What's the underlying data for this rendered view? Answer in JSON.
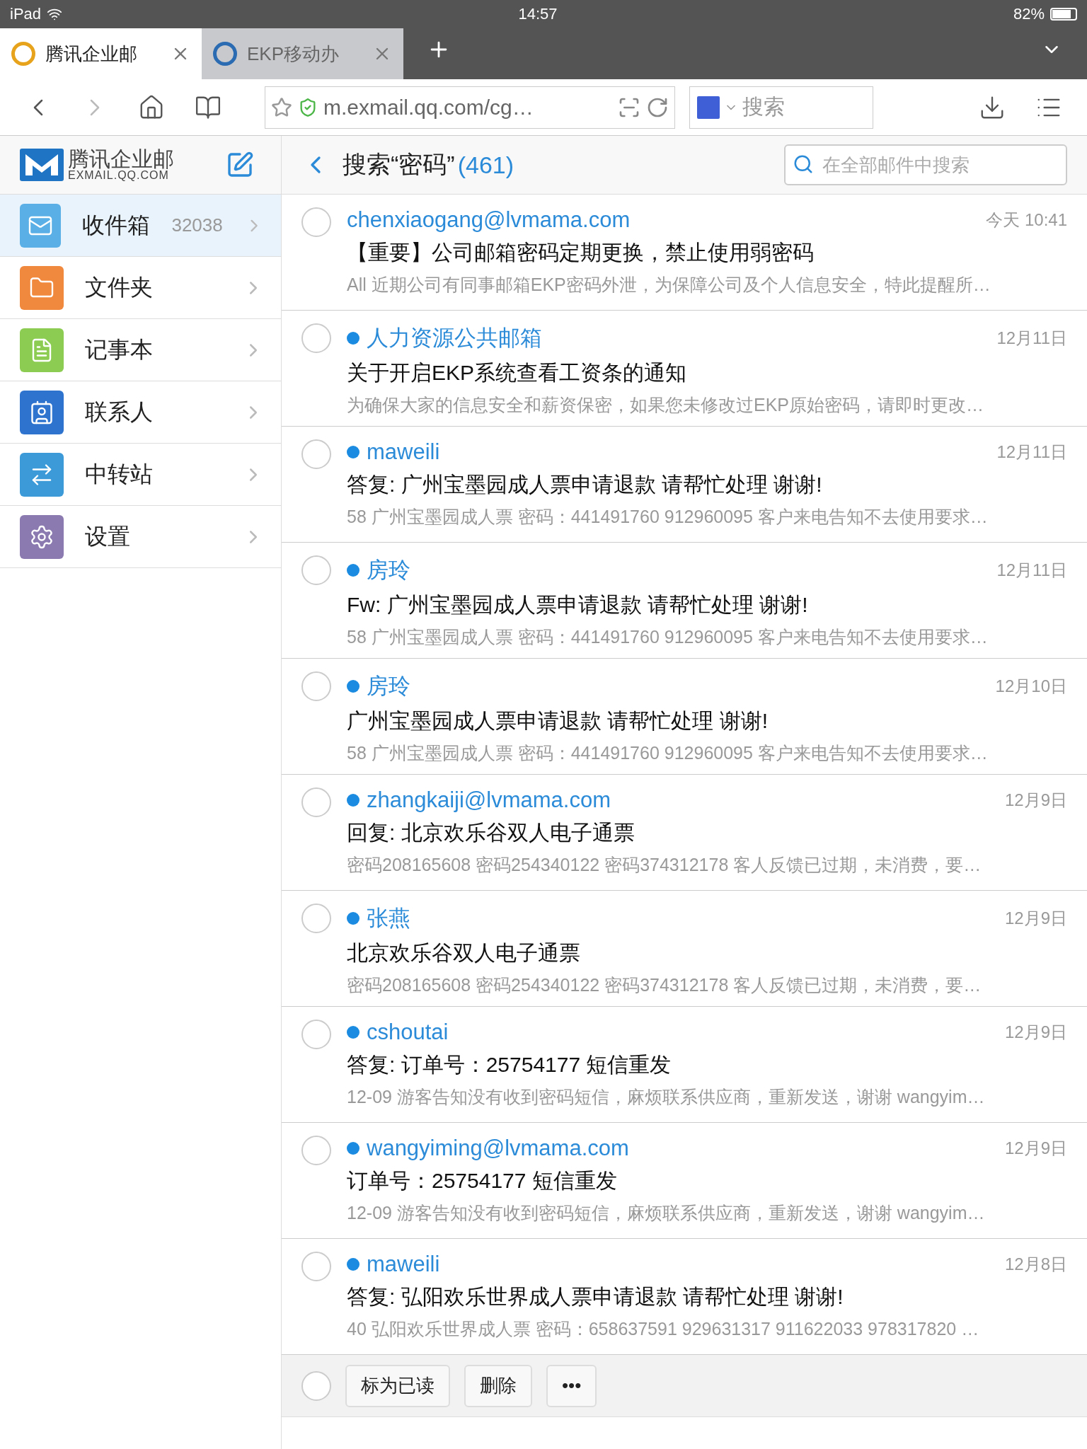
{
  "status_bar": {
    "device": "iPad",
    "time": "14:57",
    "battery": "82%"
  },
  "browser_tabs": [
    {
      "label": "腾讯企业邮",
      "selected": true
    },
    {
      "label": "EKP移动办",
      "selected": false
    }
  ],
  "address_bar": {
    "url": "m.exmail.qq.com/cg…",
    "search_placeholder": "搜索"
  },
  "sidebar": {
    "logo_title": "腾讯企业邮",
    "logo_subtitle": "EXMAIL.QQ.COM",
    "items": [
      {
        "label": "收件箱",
        "count": "32038",
        "kind": "inbox",
        "selected": true
      },
      {
        "label": "文件夹",
        "kind": "folder",
        "selected": false
      },
      {
        "label": "记事本",
        "kind": "notes",
        "selected": false
      },
      {
        "label": "联系人",
        "kind": "contacts",
        "selected": false
      },
      {
        "label": "中转站",
        "kind": "transfer",
        "selected": false
      },
      {
        "label": "设置",
        "kind": "settings",
        "selected": false
      }
    ]
  },
  "header": {
    "title": "搜索“密码”",
    "count": "(461)",
    "search_placeholder": "在全部邮件中搜索"
  },
  "messages": [
    {
      "sender": "chenxiaogang@lvmama.com",
      "date": "今天 10:41",
      "subject": "【重要】公司邮箱密码定期更换，禁止使用弱密码",
      "preview": "All 近期公司有同事邮箱EKP密码外泄，为保障公司及个人信息安全，特此提醒所…",
      "unread": false,
      "checked": false
    },
    {
      "sender": "人力资源公共邮箱",
      "date": "12月11日",
      "subject": "关于开启EKP系统查看工资条的通知",
      "preview": "为确保大家的信息安全和薪资保密，如果您未修改过EKP原始密码，请即时更改…",
      "unread": true,
      "checked": false
    },
    {
      "sender": "maweili",
      "date": "12月11日",
      "subject": "答复: 广州宝墨园成人票申请退款 请帮忙处理 谢谢!",
      "preview": "58 广州宝墨园成人票 密码：441491760 912960095 客户来电告知不去使用要求…",
      "unread": true,
      "checked": false
    },
    {
      "sender": "房玲",
      "date": "12月11日",
      "subject": "Fw: 广州宝墨园成人票申请退款 请帮忙处理 谢谢!",
      "preview": "58 广州宝墨园成人票 密码：441491760 912960095 客户来电告知不去使用要求…",
      "unread": true,
      "checked": false
    },
    {
      "sender": "房玲",
      "date": "12月10日",
      "subject": "广州宝墨园成人票申请退款 请帮忙处理 谢谢!",
      "preview": "58 广州宝墨园成人票 密码：441491760 912960095 客户来电告知不去使用要求…",
      "unread": true,
      "checked": false
    },
    {
      "sender": "zhangkaiji@lvmama.com",
      "date": "12月9日",
      "subject": "回复: 北京欢乐谷双人电子通票",
      "preview": "密码208165608 密码254340122 密码374312178 客人反馈已过期，未消费，要…",
      "unread": true,
      "checked": false
    },
    {
      "sender": "张燕",
      "date": "12月9日",
      "subject": "北京欢乐谷双人电子通票",
      "preview": "密码208165608 密码254340122 密码374312178 客人反馈已过期，未消费，要…",
      "unread": true,
      "checked": false
    },
    {
      "sender": "cshoutai",
      "date": "12月9日",
      "subject": "答复: 订单号：25754177 短信重发",
      "preview": "12-09 游客告知没有收到密码短信，麻烦联系供应商，重新发送，谢谢 wangyim…",
      "unread": true,
      "checked": false
    },
    {
      "sender": "wangyiming@lvmama.com",
      "date": "12月9日",
      "subject": "订单号：25754177 短信重发",
      "preview": "12-09 游客告知没有收到密码短信，麻烦联系供应商，重新发送，谢谢 wangyim…",
      "unread": true,
      "checked": false
    },
    {
      "sender": "maweili",
      "date": "12月8日",
      "subject": "答复: 弘阳欢乐世界成人票申请退款 请帮忙处理 谢谢!",
      "preview": "40 弘阳欢乐世界成人票 密码：658637591 929631317 911622033 978317820 …",
      "unread": true,
      "checked": false
    }
  ],
  "action_bar": {
    "select_all_checked": false,
    "buttons": [
      "标为已读",
      "删除",
      "•••"
    ]
  }
}
